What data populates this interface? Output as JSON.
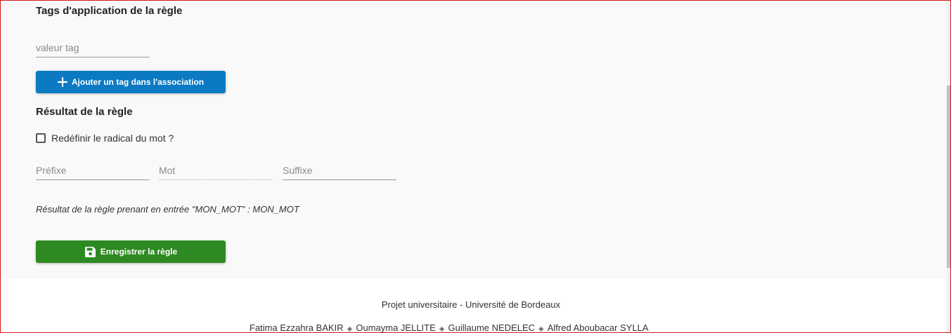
{
  "tags_section": {
    "title": "Tags d'application de la règle",
    "tag_input_placeholder": "valeur tag",
    "add_tag_button": "Ajouter un tag dans l'association"
  },
  "result_section": {
    "title": "Résultat de la règle",
    "redefine_checkbox_label": "Redéfinir le radical du mot ?",
    "redefine_checked": false,
    "prefix_placeholder": "Préfixe",
    "word_placeholder": "Mot",
    "suffix_placeholder": "Suffixe",
    "result_text": "Résultat de la règle prenant en entrée \"MON_MOT\" : MON_MOT",
    "save_button": "Enregistrer la règle"
  },
  "footer": {
    "project": "Projet universitaire - Université de Bordeaux",
    "authors": [
      "Fatima Ezzahra BAKIR",
      "Oumayma JELLITE",
      "Guillaume NEDELEC",
      "Alfred Aboubacar SYLLA"
    ],
    "separator": "◈"
  },
  "colors": {
    "add_button": "#0b7ac3",
    "save_button": "#2d8a22"
  }
}
